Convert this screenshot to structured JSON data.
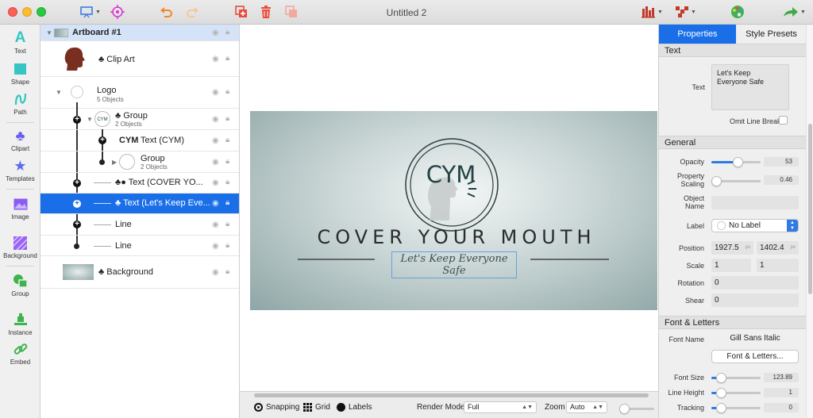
{
  "window": {
    "title": "Untitled 2"
  },
  "tools": [
    {
      "label": "Text",
      "icon": "text-tool-icon"
    },
    {
      "label": "Shape",
      "icon": "shape-tool-icon"
    },
    {
      "label": "Path",
      "icon": "path-tool-icon"
    },
    {
      "label": "Clipart",
      "icon": "clipart-tool-icon"
    },
    {
      "label": "Templates",
      "icon": "templates-tool-icon"
    },
    {
      "label": "Image",
      "icon": "image-tool-icon"
    },
    {
      "label": "Background",
      "icon": "background-tool-icon"
    },
    {
      "label": "Group",
      "icon": "group-tool-icon"
    },
    {
      "label": "Instance",
      "icon": "instance-tool-icon"
    },
    {
      "label": "Embed",
      "icon": "embed-tool-icon"
    }
  ],
  "layers": {
    "artboard": "Artboard #1",
    "clipart": "Clip Art",
    "logo": {
      "name": "Logo",
      "sub": "5 Objects"
    },
    "group1": {
      "name": "Group",
      "sub": "2 Objects"
    },
    "text_cym": "Text (CYM)",
    "text_cym_prefix": "CYM",
    "group2": {
      "name": "Group",
      "sub": "2 Objects"
    },
    "text_cover": "Text (COVER YO...",
    "text_keep": "Text (Let's Keep Eve...",
    "line1": "Line",
    "line2": "Line",
    "background": "Background"
  },
  "artboard": {
    "logo_text": "CYM",
    "title_text": "COVER YOUR MOUTH",
    "tagline": "Let's Keep Everyone Safe"
  },
  "bottom": {
    "snapping": "Snapping",
    "grid": "Grid",
    "labels": "Labels",
    "render_mode_label": "Render Mode",
    "render_mode_value": "Full",
    "zoom_label": "Zoom",
    "zoom_value": "Auto"
  },
  "inspector": {
    "tabs": [
      "Properties",
      "Style Presets"
    ],
    "sections": {
      "text": "Text",
      "general": "General",
      "font": "Font & Letters"
    },
    "text_label": "Text",
    "text_value_line1": "Let's Keep",
    "text_value_line2": "Everyone Safe",
    "omit_line_breaks": "Omit Line Breaks",
    "opacity": {
      "label": "Opacity",
      "value": "53",
      "fraction": 0.53
    },
    "property_scaling": {
      "label1": "Property",
      "label2": "Scaling",
      "value": "0.46",
      "fraction": 0.1
    },
    "object_name": {
      "label1": "Object",
      "label2": "Name",
      "value": ""
    },
    "label": {
      "label": "Label",
      "value": "No Label"
    },
    "position": {
      "label": "Position",
      "x": "1927.5",
      "y": "1402.4",
      "unit": "px"
    },
    "scale": {
      "label": "Scale",
      "x": "1",
      "y": "1"
    },
    "rotation": {
      "label": "Rotation",
      "value": "0"
    },
    "shear": {
      "label": "Shear",
      "value": "0"
    },
    "font_name": {
      "label": "Font Name",
      "value": "Gill Sans Italic"
    },
    "font_button": "Font & Letters...",
    "font_size": {
      "label": "Font Size",
      "value": "123.89",
      "fraction": 0.2
    },
    "line_height": {
      "label": "Line Height",
      "value": "1",
      "fraction": 0.2
    },
    "tracking": {
      "label": "Tracking",
      "value": "0",
      "fraction": 0.2
    }
  },
  "colors": {
    "accent": "#1a6fe8",
    "logo_dark": "#234345",
    "tool_teal": "#35c6c3",
    "tool_purple": "#8a5cf0"
  }
}
